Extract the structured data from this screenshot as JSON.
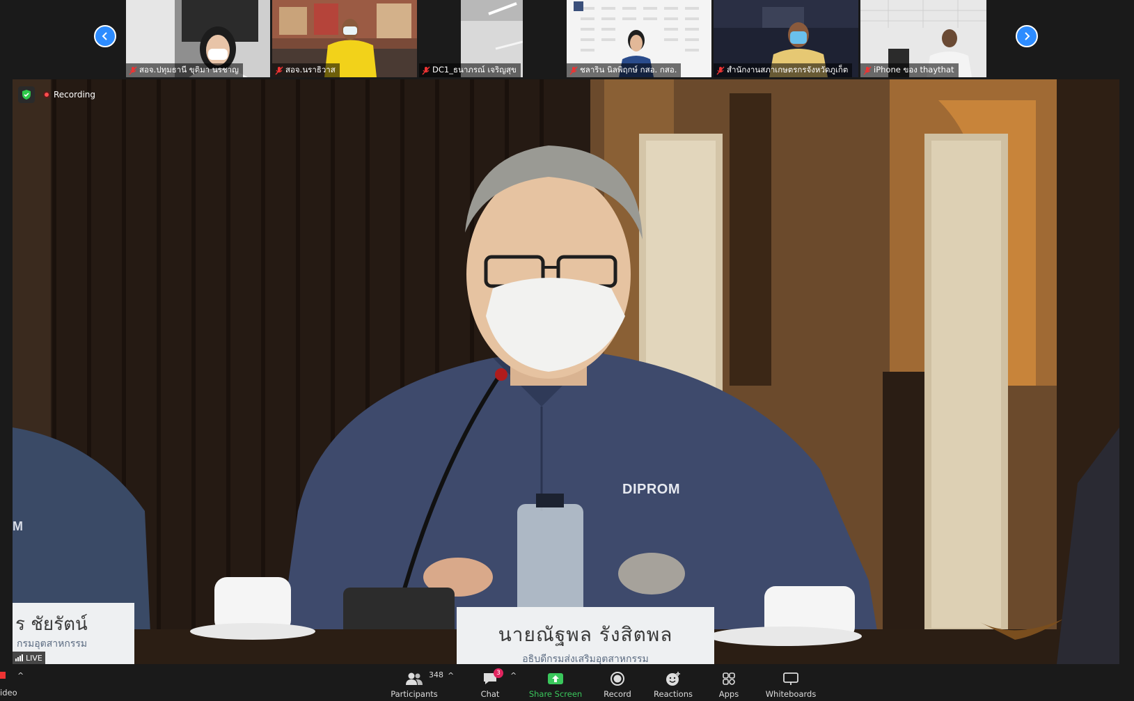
{
  "participants": [
    {
      "name": "สอจ.ปทุมธานี ขุติมา นรชาญ"
    },
    {
      "name": "สอจ.นราธิวาส"
    },
    {
      "name": "DC1_ธนาภรณ์ เจริญสุข"
    },
    {
      "name": "ชลาริน  นิลพิฤกษ์ กสอ. กสอ."
    },
    {
      "name": "สำนักงานสภาเกษตรกรจังหวัดภูเก็ต"
    },
    {
      "name": "iPhone ของ thaythat"
    }
  ],
  "main_video": {
    "recording_label": "Recording",
    "live_label": "LIVE",
    "shirt_logo": "DIPROM",
    "shirt_logo_left": "M",
    "nameplate_main": {
      "name": "นายณัฐพล รังสิตพล",
      "title": "อธิบดีกรมส่งเสริมอุตสาหกรรม"
    },
    "nameplate_left": {
      "name": "ร ชัยรัตน์",
      "title": "กรมอุตสาหกรรม"
    }
  },
  "toolbar": {
    "video_label": "ideo",
    "participants_label": "Participants",
    "participants_count": "348",
    "chat_label": "Chat",
    "chat_badge": "3",
    "share_label": "Share Screen",
    "record_label": "Record",
    "reactions_label": "Reactions",
    "apps_label": "Apps",
    "whiteboards_label": "Whiteboards",
    "caret": "^"
  },
  "colors": {
    "accent_blue": "#2d8cff",
    "share_green": "#3ac75c",
    "badge_red": "#e0245e",
    "recording_red": "#ff4d4d"
  }
}
